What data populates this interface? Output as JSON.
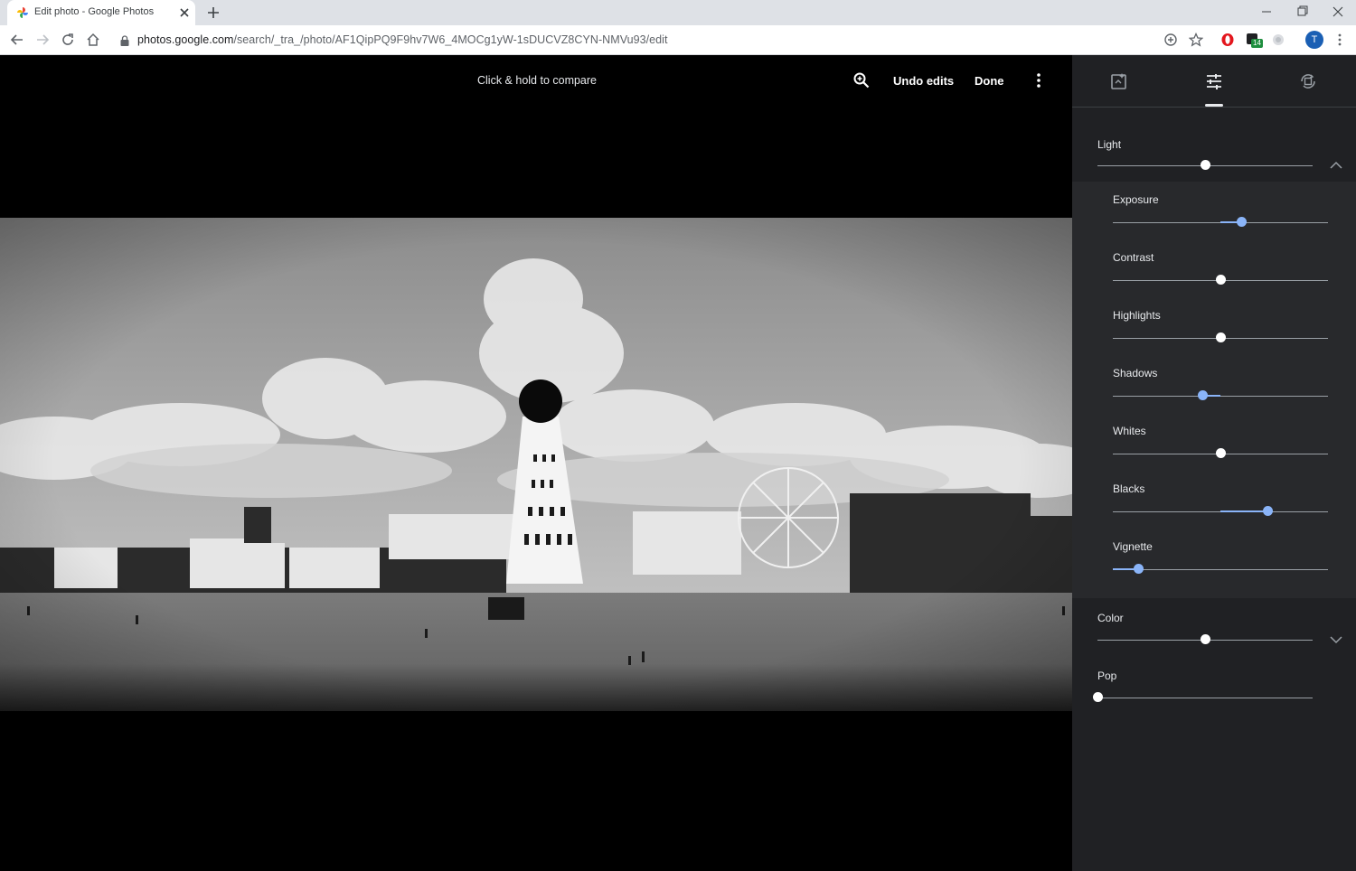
{
  "browser": {
    "tab_title": "Edit photo - Google Photos",
    "url_host": "photos.google.com",
    "url_path": "/search/_tra_/photo/AF1QipPQ9F9hv7W6_4MOCg1yW-1sDUCVZ8CYN-NMVu93/edit",
    "extension_badge": "14",
    "avatar_letter": "T"
  },
  "editor": {
    "compare_hint": "Click & hold to compare",
    "undo_label": "Undo edits",
    "done_label": "Done"
  },
  "panel": {
    "active_tab": "adjustments",
    "light": {
      "label": "Light",
      "value": 0.5,
      "expanded": true,
      "sliders": [
        {
          "label": "Exposure",
          "value": 0.6,
          "adjusted": true
        },
        {
          "label": "Contrast",
          "value": 0.5,
          "adjusted": false
        },
        {
          "label": "Highlights",
          "value": 0.5,
          "adjusted": false
        },
        {
          "label": "Shadows",
          "value": 0.42,
          "adjusted": true
        },
        {
          "label": "Whites",
          "value": 0.5,
          "adjusted": false
        },
        {
          "label": "Blacks",
          "value": 0.72,
          "adjusted": true
        },
        {
          "label": "Vignette",
          "value": 0.12,
          "adjusted": true
        }
      ]
    },
    "color": {
      "label": "Color",
      "value": 0.5,
      "expanded": false
    },
    "pop": {
      "label": "Pop",
      "value": 0.0
    }
  },
  "colors": {
    "accent": "#8ab4f8",
    "panel_bg": "#202124",
    "panel_group_bg": "#28292c"
  }
}
